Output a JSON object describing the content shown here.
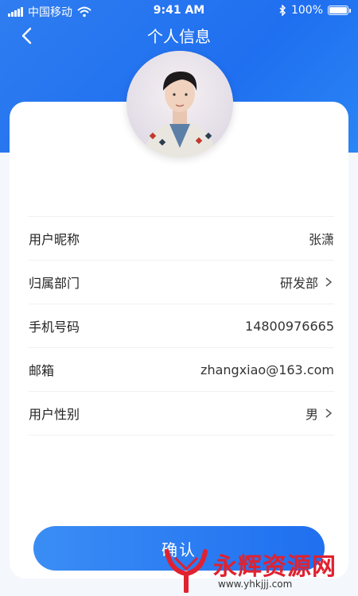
{
  "status_bar": {
    "carrier": "中国移动",
    "time": "9:41 AM",
    "battery_text": "100%",
    "battery_level": 1.0
  },
  "nav": {
    "title": "个人信息"
  },
  "form": {
    "rows": [
      {
        "label": "用户昵称",
        "value": "张潇",
        "has_chevron": false
      },
      {
        "label": "归属部门",
        "value": "研发部",
        "has_chevron": true
      },
      {
        "label": "手机号码",
        "value": "14800976665",
        "has_chevron": false
      },
      {
        "label": "邮箱",
        "value": "zhangxiao@163.com",
        "has_chevron": false
      },
      {
        "label": "用户性别",
        "value": "男",
        "has_chevron": true
      }
    ]
  },
  "confirm_label": "确认",
  "watermark": {
    "text": "永辉资源网",
    "url": "www.yhkjjj.com"
  },
  "colors": {
    "primary": "#1f6ff0",
    "watermark": "#e02230"
  },
  "icons": [
    "signal-icon",
    "wifi-icon",
    "bluetooth-icon",
    "battery-icon",
    "back-chevron-icon",
    "chevron-right-icon"
  ]
}
